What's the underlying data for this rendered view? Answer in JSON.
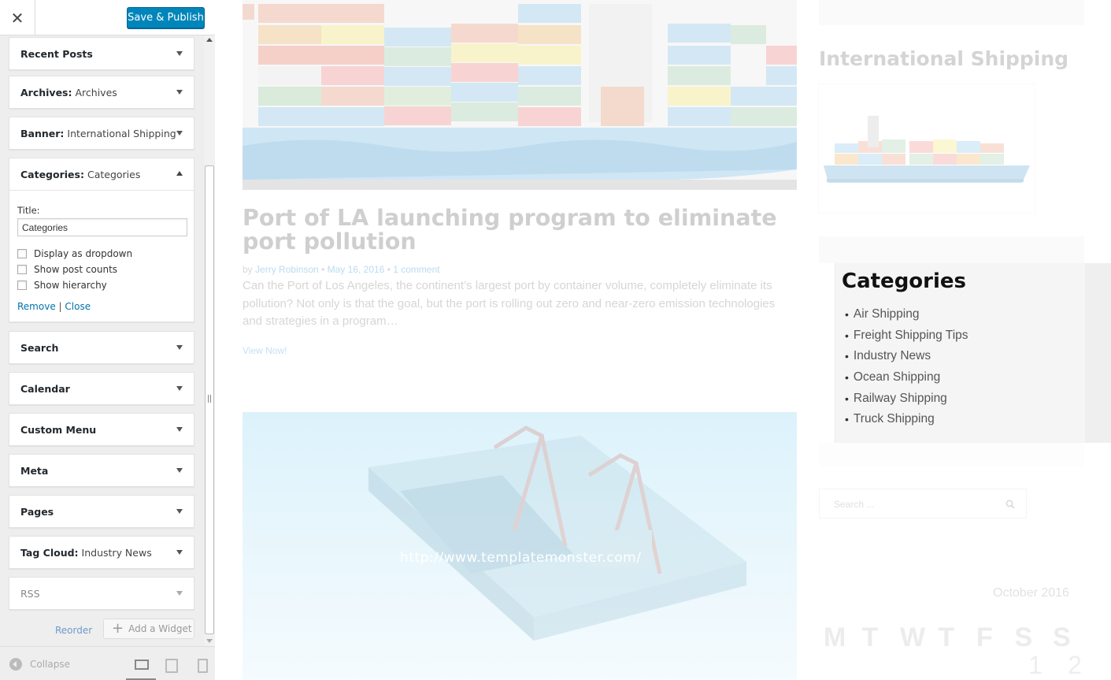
{
  "customizer": {
    "close_glyph": "✕",
    "publish_label": "Save & Publish",
    "widgets": [
      {
        "name": "Recent Posts",
        "sub": ""
      },
      {
        "name": "Archives:",
        "sub": "Archives"
      },
      {
        "name": "Banner:",
        "sub": "International Shipping"
      },
      {
        "name": "Categories:",
        "sub": "Categories"
      },
      {
        "name": "Search",
        "sub": ""
      },
      {
        "name": "Calendar",
        "sub": ""
      },
      {
        "name": "Custom Menu",
        "sub": ""
      },
      {
        "name": "Meta",
        "sub": ""
      },
      {
        "name": "Pages",
        "sub": ""
      },
      {
        "name": "Tag Cloud:",
        "sub": "Industry News"
      },
      {
        "name": "RSS",
        "sub": ""
      }
    ],
    "categories_form": {
      "title_label": "Title:",
      "title_value": "Categories",
      "option_dropdown": "Display as dropdown",
      "option_counts": "Show post counts",
      "option_hierarchy": "Show hierarchy",
      "remove_label": "Remove",
      "separator": "|",
      "close_label": "Close"
    },
    "reorder_label": "Reorder",
    "add_widget_label": "Add a Widget",
    "add_widget_glyph": "+",
    "collapse_label": "Collapse"
  },
  "preview": {
    "post": {
      "title": "Port of LA launching program to eliminate port pollution",
      "meta_by": "by",
      "author": "Jerry Robinson",
      "date": "May 16, 2016",
      "comments": "1 comment",
      "meta_sep": "•",
      "excerpt": "Can the Port of Los Angeles, the continent’s largest port by container volume, completely eliminate its pollution? Not only is that the goal, but the port is rolling out zero and near-zero emission technologies and strategies in a program…",
      "read_more": "View Now!"
    },
    "watermark": "http://www.templatemonster.com/",
    "banner_title": "International Shipping",
    "categories_title": "Categories",
    "categories": [
      "Air Shipping",
      "Freight Shipping Tips",
      "Industry News",
      "Ocean Shipping",
      "Railway Shipping",
      "Truck Shipping"
    ],
    "search_placeholder": "Search ...",
    "calendar_caption": "October 2016",
    "calendar_head": [
      "M",
      "T",
      "W",
      "T",
      "F",
      "S",
      "S"
    ],
    "calendar_days": [
      "1",
      "2"
    ]
  },
  "colors": {
    "publish_button": "#0085ba",
    "link": "#0073aa",
    "panel_bg": "#eeeeee"
  }
}
